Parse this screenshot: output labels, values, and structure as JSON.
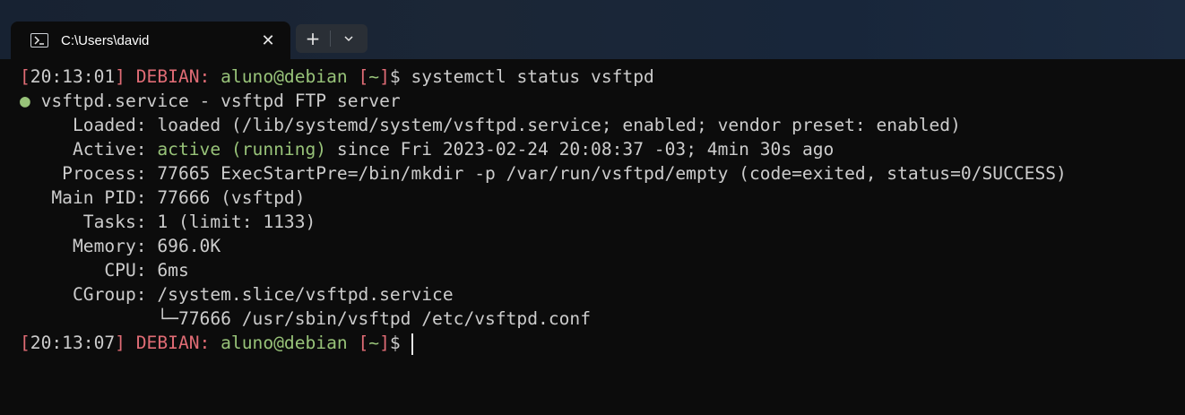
{
  "tab": {
    "title": "C:\\Users\\david",
    "close_glyph": "✕",
    "icon": "powershell-icon"
  },
  "actions": {
    "new_tab_glyph": "+",
    "dropdown_icon": "chevron-down-icon"
  },
  "terminal": {
    "prompt1": {
      "open": "[",
      "time": "20:13:01",
      "close": "]",
      "host": " DEBIAN:",
      "user": " aluno@debian",
      "dir_open": " [",
      "dir": "~",
      "dir_close": "]",
      "symbol": "$",
      "command": " systemctl status vsftpd"
    },
    "service_line": " vsftpd.service - vsftpd FTP server",
    "service_dot": "●",
    "loaded": "     Loaded: loaded (/lib/systemd/system/vsftpd.service; enabled; vendor preset: enabled)",
    "active_label": "     Active: ",
    "active_state": "active (running)",
    "active_rest": " since Fri 2023-02-24 20:08:37 -03; 4min 30s ago",
    "process": "    Process: 77665 ExecStartPre=/bin/mkdir -p /var/run/vsftpd/empty (code=exited, status=0/SUCCESS)",
    "main_pid": "   Main PID: 77666 (vsftpd)",
    "tasks": "      Tasks: 1 (limit: 1133)",
    "memory": "     Memory: 696.0K",
    "cpu": "        CPU: 6ms",
    "cgroup": "     CGroup: /system.slice/vsftpd.service",
    "cgroup_child": "             └─77666 /usr/sbin/vsftpd /etc/vsftpd.conf",
    "prompt2": {
      "open": "[",
      "time": "20:13:07",
      "close": "]",
      "host": " DEBIAN:",
      "user": " aluno@debian",
      "dir_open": " [",
      "dir": "~",
      "dir_close": "]",
      "symbol": "$"
    }
  }
}
